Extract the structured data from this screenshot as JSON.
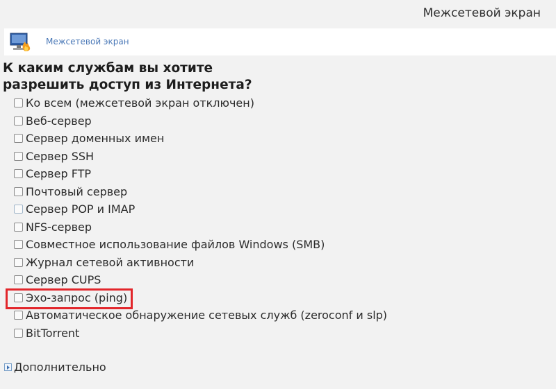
{
  "window": {
    "title": "Межсетевой экран"
  },
  "banner": {
    "link_label": "Межсетевой экран",
    "icon": "firewall-icon"
  },
  "question": {
    "line1": "К каким службам вы хотите",
    "line2": "разрешить доступ из Интернета?"
  },
  "services": [
    {
      "label": "Ко всем (межсетевой экран отключен)",
      "checked": false
    },
    {
      "label": "Веб-сервер",
      "checked": false
    },
    {
      "label": "Сервер доменных имен",
      "checked": false
    },
    {
      "label": "Сервер SSH",
      "checked": false
    },
    {
      "label": "Сервер FTP",
      "checked": false
    },
    {
      "label": "Почтовый сервер",
      "checked": false
    },
    {
      "label": "Сервер POP и IMAP",
      "checked": false
    },
    {
      "label": "NFS-сервер",
      "checked": false
    },
    {
      "label": "Совместное использование файлов Windows (SMB)",
      "checked": false
    },
    {
      "label": "Журнал сетевой активности",
      "checked": false
    },
    {
      "label": "Сервер CUPS",
      "checked": false
    },
    {
      "label": "Эхо-запрос (ping)",
      "checked": false
    },
    {
      "label": "Автоматическое обнаружение сетевых служб (zeroconf и slp)",
      "checked": false
    },
    {
      "label": "BitTorrent",
      "checked": false
    }
  ],
  "advanced": {
    "label": "Дополнительно",
    "icon": "expand-arrow-icon"
  },
  "colors": {
    "background": "#f2f2f2",
    "banner_background": "#ffffff",
    "link": "#4a78b7",
    "highlight": "#e2262b"
  }
}
